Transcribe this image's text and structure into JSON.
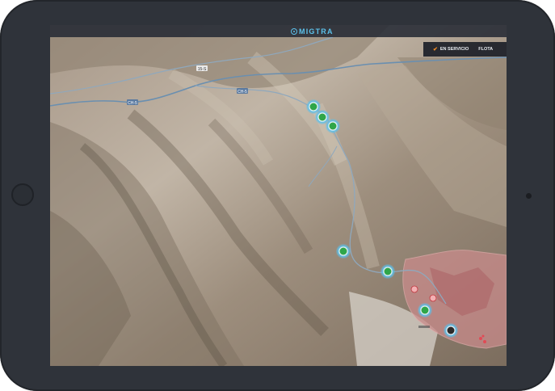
{
  "app": {
    "logo_text": "MIGTRA"
  },
  "menu": {
    "active_item": "EN SERVICIO",
    "item2": "FLOTA"
  },
  "map": {
    "road_labels": [
      "CH-5",
      "CH-5",
      "15-S"
    ]
  },
  "colors": {
    "accent": "#5bc0ea",
    "check": "#f08a24",
    "vehicle_green": "#2fa64a",
    "zone": "#c98b8b"
  }
}
